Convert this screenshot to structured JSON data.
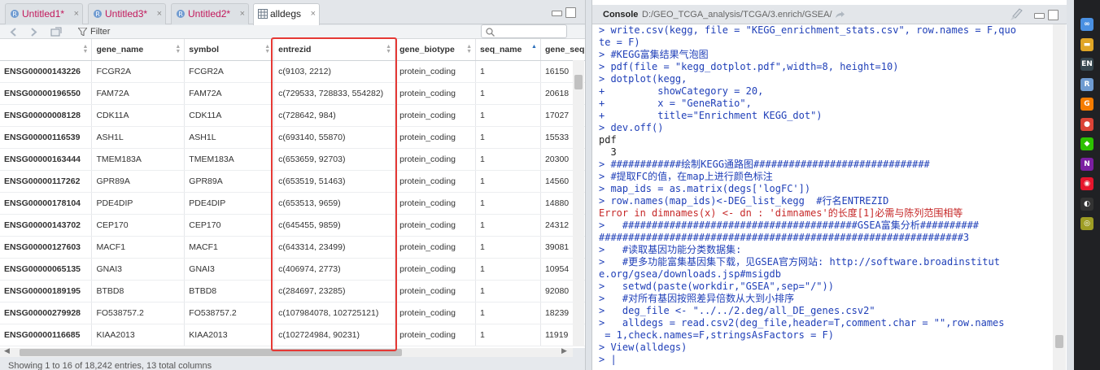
{
  "tabs": [
    {
      "label": "Untitled1*",
      "close": "×"
    },
    {
      "label": "Untitled3*",
      "close": "×"
    },
    {
      "label": "Untitled2*",
      "close": "×"
    },
    {
      "label": "alldegs",
      "close": "×"
    }
  ],
  "toolbar": {
    "filter_label": "Filter"
  },
  "table": {
    "columns": [
      "gene_name",
      "symbol",
      "entrezid",
      "gene_biotype",
      "seq_name",
      "gene_seq"
    ],
    "rows": [
      [
        "ENSG00000143226",
        "FCGR2A",
        "FCGR2A",
        "c(9103, 2212)",
        "protein_coding",
        "1",
        "16150"
      ],
      [
        "ENSG00000196550",
        "FAM72A",
        "FAM72A",
        "c(729533, 728833, 554282)",
        "protein_coding",
        "1",
        "20618"
      ],
      [
        "ENSG00000008128",
        "CDK11A",
        "CDK11A",
        "c(728642, 984)",
        "protein_coding",
        "1",
        "17027"
      ],
      [
        "ENSG00000116539",
        "ASH1L",
        "ASH1L",
        "c(693140, 55870)",
        "protein_coding",
        "1",
        "15533"
      ],
      [
        "ENSG00000163444",
        "TMEM183A",
        "TMEM183A",
        "c(653659, 92703)",
        "protein_coding",
        "1",
        "20300"
      ],
      [
        "ENSG00000117262",
        "GPR89A",
        "GPR89A",
        "c(653519, 51463)",
        "protein_coding",
        "1",
        "14560"
      ],
      [
        "ENSG00000178104",
        "PDE4DIP",
        "PDE4DIP",
        "c(653513, 9659)",
        "protein_coding",
        "1",
        "14880"
      ],
      [
        "ENSG00000143702",
        "CEP170",
        "CEP170",
        "c(645455, 9859)",
        "protein_coding",
        "1",
        "24312"
      ],
      [
        "ENSG00000127603",
        "MACF1",
        "MACF1",
        "c(643314, 23499)",
        "protein_coding",
        "1",
        "39081"
      ],
      [
        "ENSG00000065135",
        "GNAI3",
        "GNAI3",
        "c(406974, 2773)",
        "protein_coding",
        "1",
        "10954"
      ],
      [
        "ENSG00000189195",
        "BTBD8",
        "BTBD8",
        "c(284697, 23285)",
        "protein_coding",
        "1",
        "92080"
      ],
      [
        "ENSG00000279928",
        "FO538757.2",
        "FO538757.2",
        "c(107984078, 102725121)",
        "protein_coding",
        "1",
        "18239"
      ],
      [
        "ENSG00000116685",
        "KIAA2013",
        "KIAA2013",
        "c(102724984, 90231)",
        "protein_coding",
        "1",
        "11919"
      ]
    ]
  },
  "status_text": "Showing 1 to 16 of 18,242 entries, 13 total columns",
  "console": {
    "title": "Console",
    "path": "D:/GEO_TCGA_analysis/TCGA/3.enrich/GSEA/",
    "lines": [
      {
        "t": "in",
        "s": "> write.csv(kegg, file = \"KEGG_enrichment_stats.csv\", row.names = F,quo"
      },
      {
        "t": "in",
        "s": "te = F)"
      },
      {
        "t": "in",
        "s": "> #KEGG富集结果气泡图"
      },
      {
        "t": "in",
        "s": "> pdf(file = \"kegg_dotplot.pdf\",width=8, height=10)"
      },
      {
        "t": "in",
        "s": "> dotplot(kegg,"
      },
      {
        "t": "in",
        "s": "+         showCategory = 20,"
      },
      {
        "t": "in",
        "s": "+         x = \"GeneRatio\","
      },
      {
        "t": "in",
        "s": "+         title=\"Enrichment KEGG_dot\")"
      },
      {
        "t": "in",
        "s": "> dev.off()"
      },
      {
        "t": "out",
        "s": "pdf "
      },
      {
        "t": "out",
        "s": "  3 "
      },
      {
        "t": "in",
        "s": "> ############绘制KEGG通路图##############################"
      },
      {
        "t": "in",
        "s": "> #提取FC的值，在map上进行颜色标注"
      },
      {
        "t": "in",
        "s": "> map_ids = as.matrix(degs['logFC'])"
      },
      {
        "t": "in",
        "s": "> row.names(map_ids)<-DEG_list_kegg  #行名ENTREZID"
      },
      {
        "t": "err",
        "s": "Error in dimnames(x) <- dn : 'dimnames'的长度[1]必需与陈列范围相等"
      },
      {
        "t": "in",
        "s": ">   ########################################GSEA富集分析##########"
      },
      {
        "t": "in",
        "s": "##############################################################3"
      },
      {
        "t": "in",
        "s": ">   #读取基因功能分类数据集:"
      },
      {
        "t": "in",
        "s": ">   #更多功能富集基因集下载，见GSEA官方网站: http://software.broadinstitut"
      },
      {
        "t": "in",
        "s": "e.org/gsea/downloads.jsp#msigdb"
      },
      {
        "t": "in",
        "s": ">   setwd(paste(workdir,\"GSEA\",sep=\"/\"))"
      },
      {
        "t": "in",
        "s": ">   #对所有基因按照差异倍数从大到小排序"
      },
      {
        "t": "in",
        "s": ">   deg_file <- \"../../2.deg/all_DE_genes.csv2\""
      },
      {
        "t": "in",
        "s": ">   alldegs = read.csv2(deg_file,header=T,comment.char = \"\",row.names"
      },
      {
        "t": "in",
        "s": " = 1,check.names=F,stringsAsFactors = F)"
      },
      {
        "t": "in",
        "s": "> View(alldegs)"
      },
      {
        "t": "in",
        "s": "> |"
      }
    ]
  },
  "taskbar_icons": [
    {
      "name": "network-icon",
      "color": "#4a90e2",
      "glyph": "∞"
    },
    {
      "name": "folder-icon",
      "color": "#e0a526",
      "glyph": "▬"
    },
    {
      "name": "language-en-icon",
      "color": "#37474f",
      "glyph": "EN"
    },
    {
      "name": "rstudio-icon",
      "color": "#6f9bd1",
      "glyph": "R"
    },
    {
      "name": "app-g-icon",
      "color": "#f57c00",
      "glyph": "G"
    },
    {
      "name": "chrome-icon",
      "color": "#db4437",
      "glyph": "●"
    },
    {
      "name": "wechat-icon",
      "color": "#2dc100",
      "glyph": "◆"
    },
    {
      "name": "onenote-icon",
      "color": "#7b1fa2",
      "glyph": "N"
    },
    {
      "name": "weibo-icon",
      "color": "#e6162d",
      "glyph": "◉"
    },
    {
      "name": "qq-icon",
      "color": "#333",
      "glyph": "◐"
    },
    {
      "name": "misc-app-icon",
      "color": "#9e9d24",
      "glyph": "◎"
    }
  ]
}
